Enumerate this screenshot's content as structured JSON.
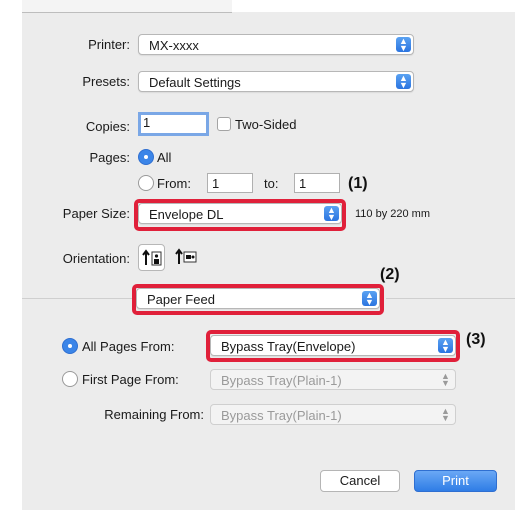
{
  "printer": {
    "label": "Printer:",
    "value": "MX-xxxx"
  },
  "presets": {
    "label": "Presets:",
    "value": "Default Settings"
  },
  "copies": {
    "label": "Copies:",
    "value": "1",
    "two_sided_label": "Two-Sided"
  },
  "pages": {
    "label": "Pages:",
    "all_label": "All",
    "from_label": "From:",
    "from_value": "1",
    "to_label": "to:",
    "to_value": "1"
  },
  "paper_size": {
    "label": "Paper Size:",
    "value": "Envelope DL",
    "dimensions": "110 by 220 mm"
  },
  "orientation": {
    "label": "Orientation:",
    "options": [
      "portrait-icon",
      "landscape-icon"
    ]
  },
  "section_menu": {
    "value": "Paper Feed"
  },
  "feed": {
    "all_pages_label": "All Pages From:",
    "all_pages_value": "Bypass Tray(Envelope)",
    "first_page_label": "First Page From:",
    "first_page_value": "Bypass Tray(Plain-1)",
    "remaining_label": "Remaining From:",
    "remaining_value": "Bypass Tray(Plain-1)"
  },
  "callouts": {
    "c1": "(1)",
    "c2": "(2)",
    "c3": "(3)"
  },
  "buttons": {
    "cancel": "Cancel",
    "print": "Print"
  },
  "colors": {
    "accent": "#3b85e8",
    "highlight": "#e0203a",
    "panel": "#ececec"
  }
}
